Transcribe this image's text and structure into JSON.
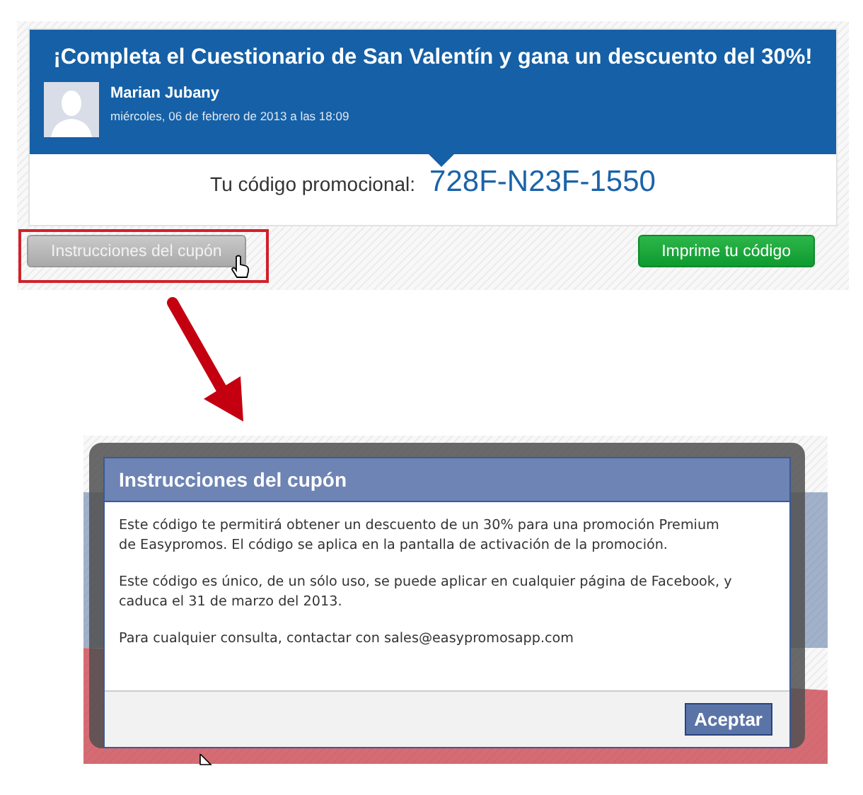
{
  "banner": {
    "title": "¡Completa el Cuestionario de San Valentín y gana un descuento del 30%!",
    "author": "Marian Jubany",
    "date": "miércoles, 06 de febrero de 2013 a las 18:09",
    "code_label": "Tu código promocional:",
    "code": "728F-N23F-1550"
  },
  "buttons": [
    {
      "label": "Instrucciones del cupón",
      "kind": "secondary",
      "highlighted": true
    },
    {
      "label": "Imprime tu código",
      "kind": "primary",
      "highlighted": false
    }
  ],
  "dialog": {
    "title": "Instrucciones del cupón",
    "paragraphs": [
      "Este código te permitirá obtener un descuento de un 30% para una promoción Premium de Easypromos. El código se aplica en la pantalla de activación de la promoción.",
      "Este código es único, de un sólo uso, se puede aplicar en cualquier página de Facebook, y caduca el 31 de marzo del 2013.",
      "Para cualquier consulta, contactar con sales@easypromosapp.com"
    ],
    "button": "Aceptar"
  }
}
